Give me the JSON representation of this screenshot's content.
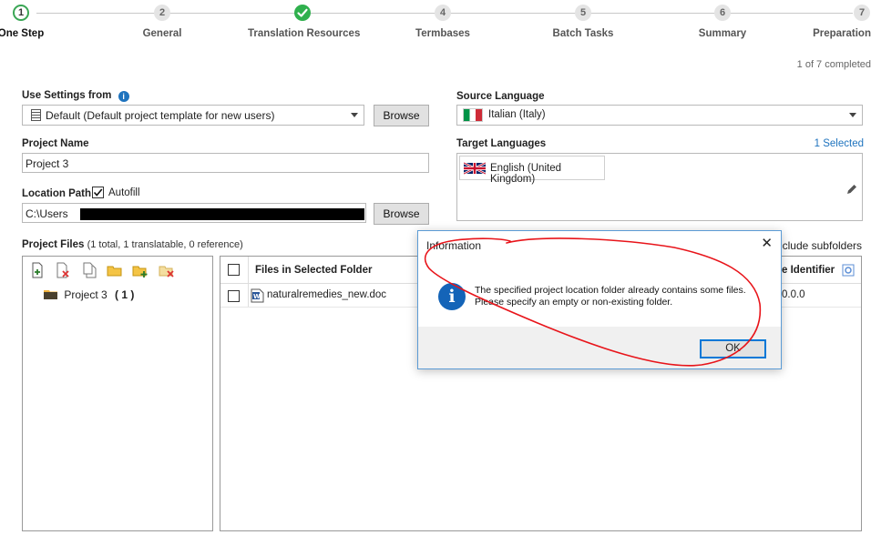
{
  "stepper": {
    "steps": [
      {
        "num": "1",
        "label": "One Step",
        "state": "current"
      },
      {
        "num": "2",
        "label": "General",
        "state": "pending"
      },
      {
        "num": "3",
        "label": "Translation Resources",
        "state": "done"
      },
      {
        "num": "4",
        "label": "Termbases",
        "state": "pending"
      },
      {
        "num": "5",
        "label": "Batch Tasks",
        "state": "pending"
      },
      {
        "num": "6",
        "label": "Summary",
        "state": "pending"
      },
      {
        "num": "7",
        "label": "Preparation",
        "state": "pending"
      }
    ],
    "progress": "1 of 7 completed"
  },
  "settings": {
    "use_settings_label": "Use Settings from",
    "template_value": "Default (Default project template for new users)",
    "browse_label": "Browse",
    "project_name_label": "Project Name",
    "project_name_value": "Project 3",
    "location_label": "Location Path",
    "autofill_label": "Autofill",
    "autofill_checked": true,
    "location_value": "C:\\Users",
    "location_browse_label": "Browse"
  },
  "languages": {
    "source_label": "Source Language",
    "source_value": "Italian (Italy)",
    "target_label": "Target Languages",
    "selected_link": "1 Selected",
    "targets": [
      "English (United Kingdom)"
    ]
  },
  "files": {
    "label": "Project Files",
    "summary": "(1 total, 1 translatable, 0 reference)",
    "tree_item": "Project 3",
    "tree_count": "( 1 )",
    "column_files": "Files in Selected Folder",
    "column_identifier": "e Identifier",
    "include_subfolders": "clude subfolders",
    "rows": [
      {
        "name": "naturalremedies_new.doc",
        "identifier": "0.0.0"
      }
    ]
  },
  "dialog": {
    "title": "Information",
    "message": "The specified project location folder already contains some files. Please specify an empty or non-existing folder.",
    "ok_label": "OK",
    "close_glyph": "✕",
    "info_glyph": "i"
  },
  "colors": {
    "accent": "#1e73be",
    "done_green": "#2fb04d",
    "annotation_red": "#e8141a"
  }
}
